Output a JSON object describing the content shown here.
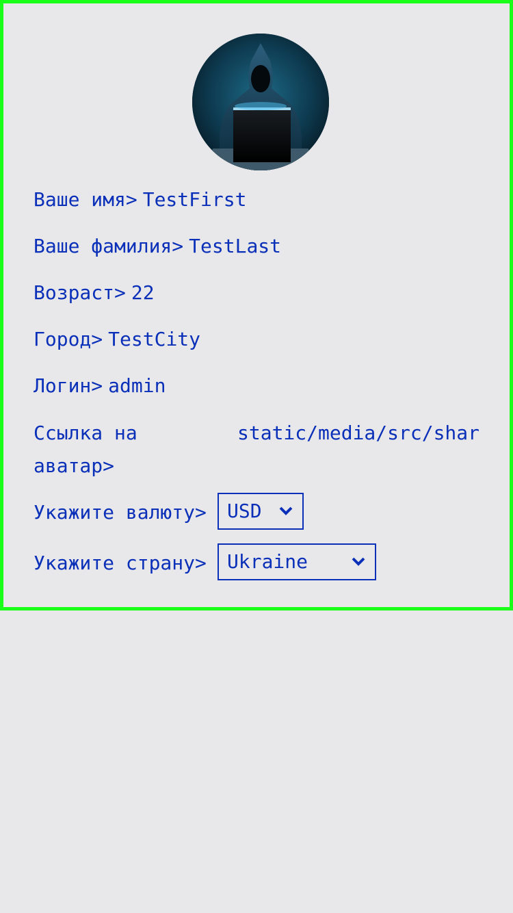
{
  "profile": {
    "first_name": {
      "label": "Ваше имя>",
      "value": "TestFirst"
    },
    "last_name": {
      "label": "Ваше фамилия>",
      "value": "TestLast"
    },
    "age": {
      "label": "Возраст>",
      "value": "22"
    },
    "city": {
      "label": "Город>",
      "value": "TestCity"
    },
    "login": {
      "label": "Логин>",
      "value": "admin"
    },
    "avatar_link": {
      "label": "Ссылка на аватар>",
      "value": "static/media/src/shar"
    },
    "currency": {
      "label": "Укажите валюту>",
      "selected": "USD"
    },
    "country": {
      "label": "Укажите страну>",
      "selected": "Ukraine"
    }
  },
  "avatar": {
    "icon": "hooded-hacker-avatar"
  },
  "colors": {
    "text": "#0a2fb8",
    "panel_border": "#19ff19",
    "background": "#e8e8ea"
  }
}
